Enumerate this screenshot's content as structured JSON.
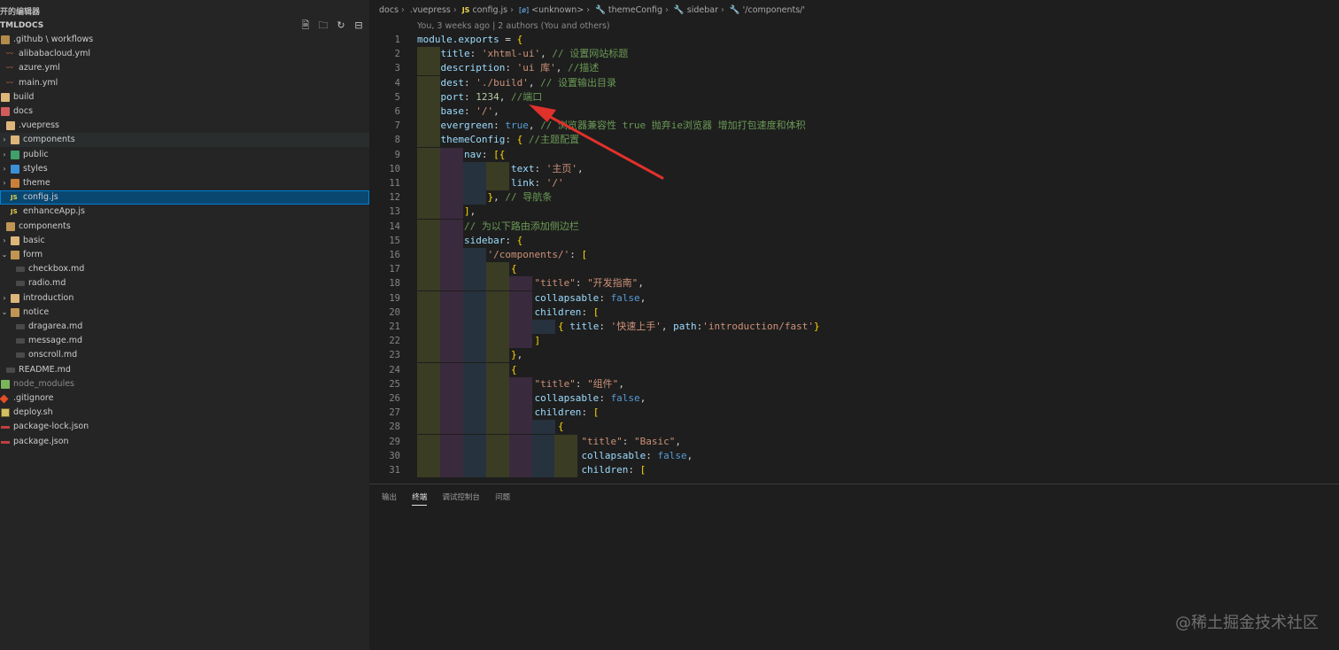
{
  "sidebar": {
    "title": "开的编辑器",
    "section": "TMLDOCS",
    "header_icons": [
      "new-file-icon",
      "new-folder-icon",
      "refresh-icon",
      "collapse-all-icon"
    ],
    "tree": [
      {
        "label": ".github \\ workflows",
        "icon": "folder-github-icon",
        "chev": "",
        "indent": 0
      },
      {
        "label": "alibabacloud.yml",
        "icon": "yml-file-icon",
        "chev": "",
        "indent": 1
      },
      {
        "label": "azure.yml",
        "icon": "yml-file-icon",
        "chev": "",
        "indent": 1
      },
      {
        "label": "main.yml",
        "icon": "yml-file-icon",
        "chev": "",
        "indent": 1
      },
      {
        "label": "build",
        "icon": "folder-icon",
        "chev": "",
        "indent": 0
      },
      {
        "label": "docs",
        "icon": "folder-docs-icon",
        "chev": "",
        "indent": 0
      },
      {
        "label": ".vuepress",
        "icon": "folder-vuepress-icon",
        "chev": "",
        "indent": 1
      },
      {
        "label": "components",
        "icon": "folder-icon",
        "chev": ">",
        "indent": 2
      },
      {
        "label": "public",
        "icon": "folder-public-icon",
        "chev": ">",
        "indent": 2
      },
      {
        "label": "styles",
        "icon": "folder-styles-icon",
        "chev": ">",
        "indent": 2
      },
      {
        "label": "theme",
        "icon": "folder-theme-icon",
        "chev": ">",
        "indent": 2
      },
      {
        "label": "config.js",
        "icon": "js-file-icon",
        "chev": "",
        "indent": 2
      },
      {
        "label": "enhanceApp.js",
        "icon": "js-file-icon",
        "chev": "",
        "indent": 2
      },
      {
        "label": "components",
        "icon": "folder-open-icon",
        "chev": "",
        "indent": 1
      },
      {
        "label": "basic",
        "icon": "folder-icon",
        "chev": ">",
        "indent": 2
      },
      {
        "label": "form",
        "icon": "folder-open-icon",
        "chev": "v",
        "indent": 2
      },
      {
        "label": "checkbox.md",
        "icon": "md-file-icon",
        "chev": "",
        "indent": 3
      },
      {
        "label": "radio.md",
        "icon": "md-file-icon",
        "chev": "",
        "indent": 3
      },
      {
        "label": "introduction",
        "icon": "folder-icon",
        "chev": ">",
        "indent": 2
      },
      {
        "label": "notice",
        "icon": "folder-open-icon",
        "chev": "v",
        "indent": 2
      },
      {
        "label": "dragarea.md",
        "icon": "md-file-icon",
        "chev": "",
        "indent": 3
      },
      {
        "label": "message.md",
        "icon": "md-file-icon",
        "chev": "",
        "indent": 3
      },
      {
        "label": "onscroll.md",
        "icon": "md-file-icon",
        "chev": "",
        "indent": 3
      },
      {
        "label": "README.md",
        "icon": "md-file-icon",
        "chev": "",
        "indent": 1
      },
      {
        "label": "node_modules",
        "icon": "folder-node-icon",
        "chev": "",
        "indent": 0
      },
      {
        "label": ".gitignore",
        "icon": "git-file-icon",
        "chev": "",
        "indent": 0
      },
      {
        "label": "deploy.sh",
        "icon": "sh-file-icon",
        "chev": "",
        "indent": 0
      },
      {
        "label": "package-lock.json",
        "icon": "json-file-icon",
        "chev": "",
        "indent": 0
      },
      {
        "label": "package.json",
        "icon": "json-file-icon",
        "chev": "",
        "indent": 0
      }
    ],
    "selected_item": "config.js",
    "hover_item": "components"
  },
  "breadcrumb": {
    "items": [
      "docs",
      ".vuepress",
      "config.js",
      "<unknown>",
      "themeConfig",
      "sidebar",
      "'/components/'"
    ],
    "js_badge": "JS",
    "sym_badge": "[ø]"
  },
  "blame": "You, 3 weeks ago | 2 authors (You and others)",
  "code": {
    "line_numbers": [
      "1",
      "2",
      "3",
      "4",
      "5",
      "6",
      "7",
      "8",
      "9",
      "10",
      "11",
      "12",
      "13",
      "14",
      "15",
      "16",
      "17",
      "18",
      "19",
      "20",
      "21",
      "22",
      "23",
      "24",
      "25",
      "26",
      "27",
      "28",
      "29",
      "30",
      "31"
    ],
    "lines": [
      "module.exports = {",
      "    title: 'xhtml-ui', // 设置网站标题",
      "    description: 'ui 库', //描述",
      "    dest: './build', // 设置输出目录",
      "    port: 1234, //端口",
      "    base: '/',",
      "    evergreen: true, // 浏览器兼容性 true 抛弃ie浏览器 增加打包速度和体积",
      "    themeConfig: { //主题配置",
      "        nav: [{",
      "                text: '主页',",
      "                link: '/'",
      "            }, // 导航条",
      "        ],",
      "        // 为以下路由添加侧边栏",
      "        sidebar: {",
      "            '/components/': [",
      "                {",
      "                    \"title\": \"开发指南\",",
      "                    collapsable: false,",
      "                    children: [",
      "                        { title: '快速上手', path:'introduction/fast'}",
      "                    ]",
      "                },",
      "                {",
      "                    \"title\": \"组件\",",
      "                    collapsable: false,",
      "                    children: [",
      "                        {",
      "                            \"title\": \"Basic\",",
      "                            collapsable: false,",
      "                            children: ["
    ]
  },
  "panel": {
    "tabs": [
      "输出",
      "终端",
      "调试控制台",
      "问题"
    ],
    "active_tab": "终端"
  },
  "watermark": "@稀土掘金技术社区",
  "colors": {
    "selection": "#094771",
    "arrow": "#e0312b",
    "background": "#1e1e1e",
    "sidebar": "#252526"
  }
}
